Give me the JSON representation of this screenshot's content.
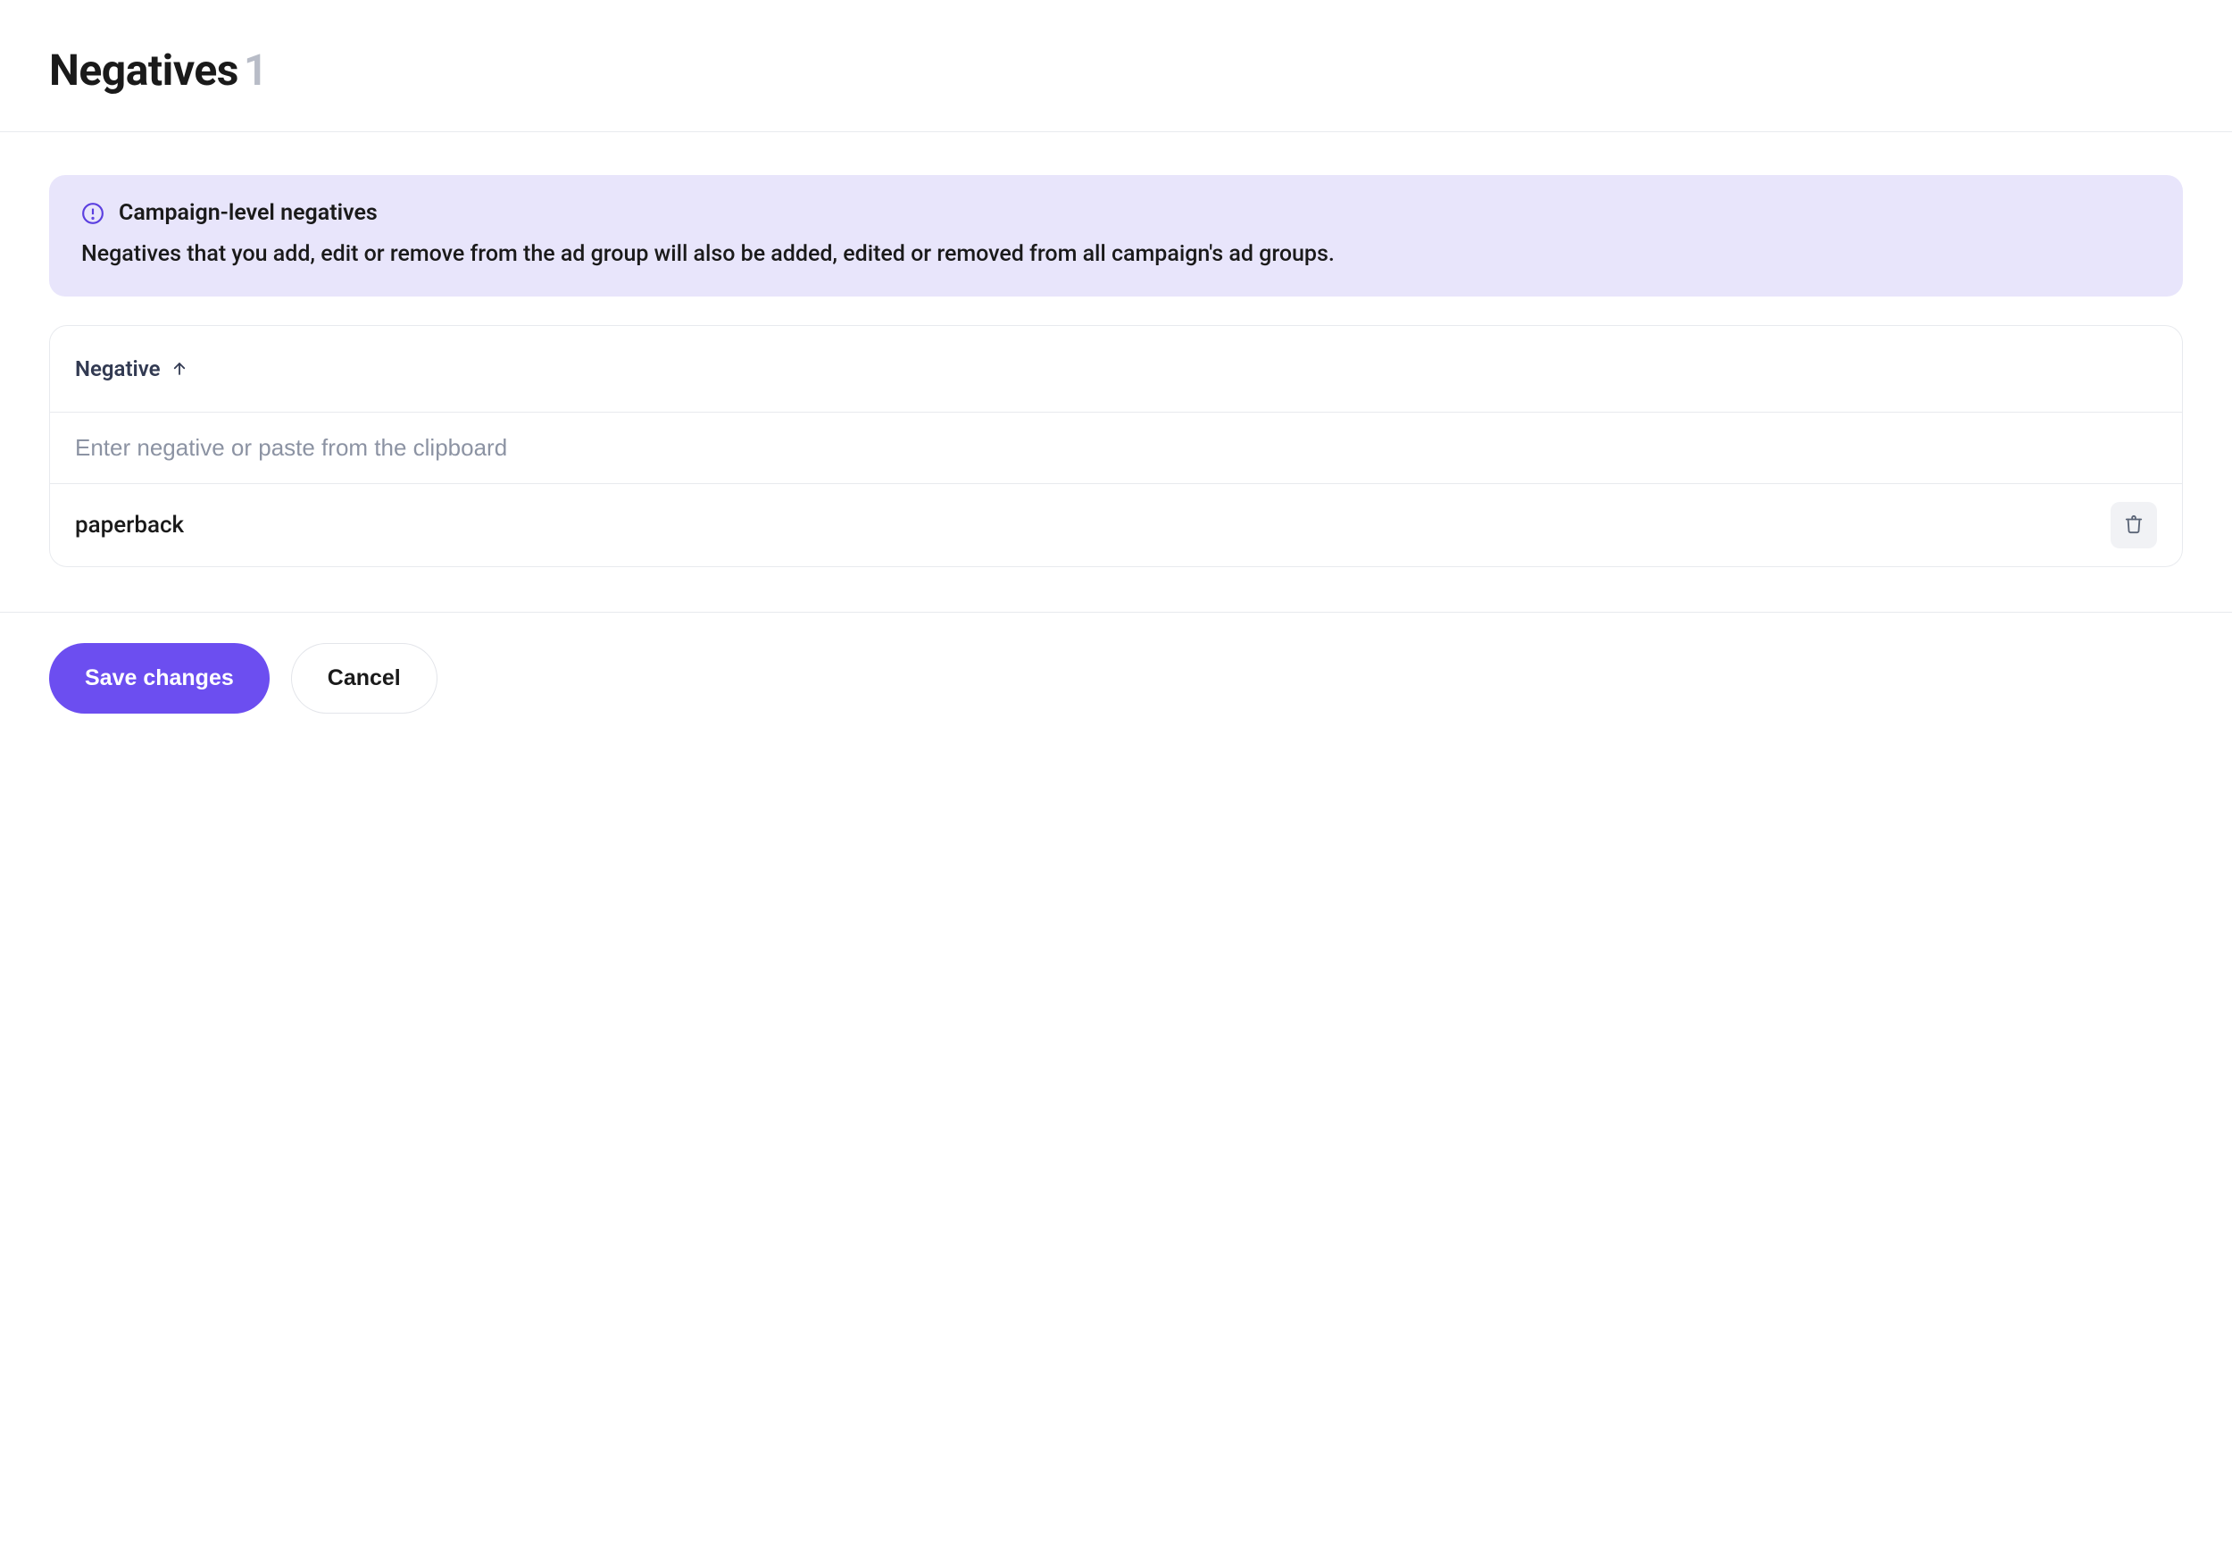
{
  "header": {
    "title": "Negatives",
    "count": "1"
  },
  "info": {
    "title": "Campaign-level negatives",
    "body": "Negatives that you add, edit or remove from the ad group will also be added, edited or removed from all campaign's ad groups."
  },
  "table": {
    "column_label": "Negative",
    "input_placeholder": "Enter negative or paste from the clipboard",
    "rows": [
      {
        "value": "paperback"
      }
    ]
  },
  "actions": {
    "save_label": "Save changes",
    "cancel_label": "Cancel"
  }
}
